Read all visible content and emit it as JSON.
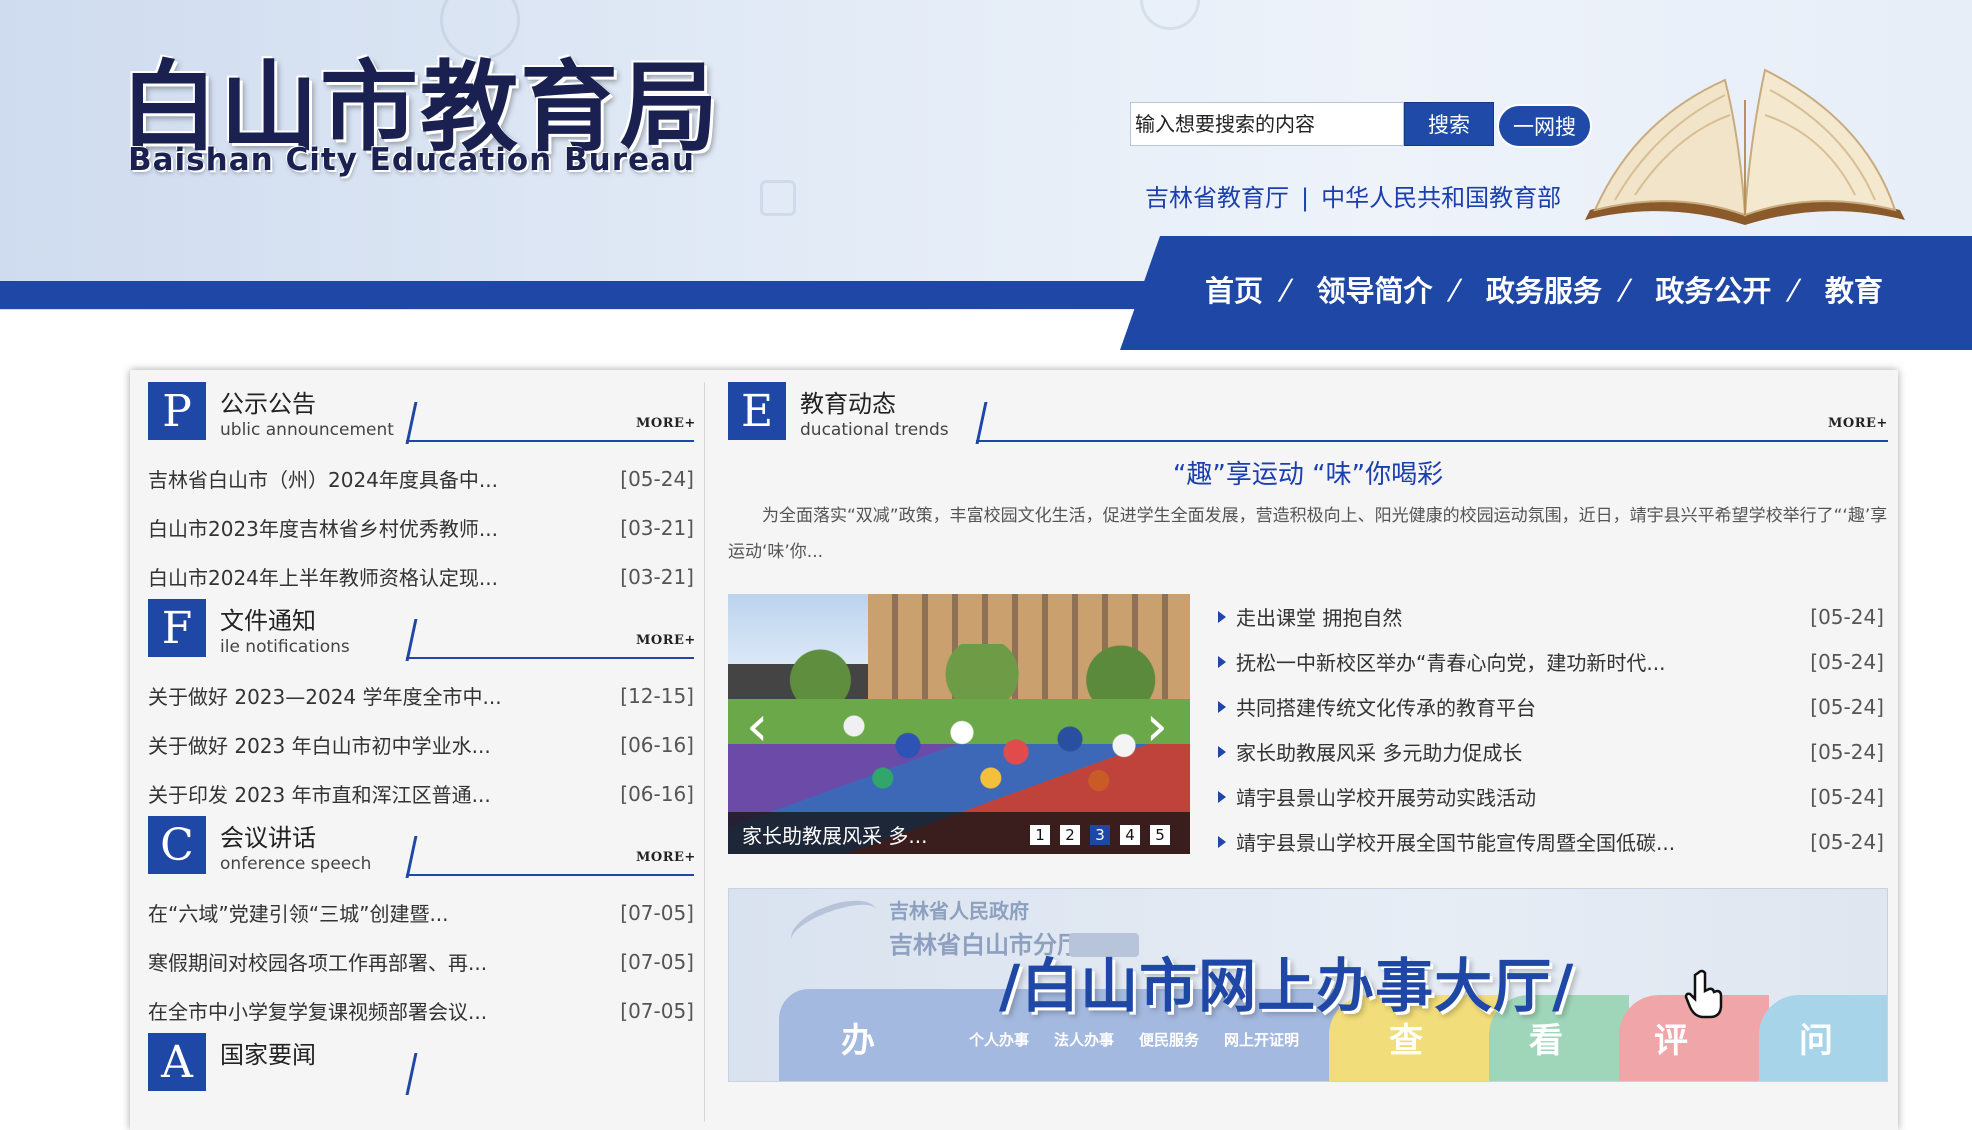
{
  "header": {
    "logo_cn": "白山市教育局",
    "logo_en": "Baishan City Education Bureau",
    "search_placeholder": "输入想要搜索的内容",
    "search_button": "搜索",
    "web_search_button": "一网搜",
    "links": [
      "吉林省教育厅",
      "中华人民共和国教育部"
    ],
    "link_separator": "|"
  },
  "nav": {
    "items": [
      "首页",
      "领导简介",
      "政务服务",
      "政务公开",
      "教育"
    ],
    "separator": "/"
  },
  "sections": [
    {
      "letter": "P",
      "title": "公示公告",
      "subtitle": "ublic announcement",
      "more": "MORE+",
      "items": [
        {
          "text": "吉林省白山市（州）2024年度具备中...",
          "date": "[05-24]"
        },
        {
          "text": "白山市2023年度吉林省乡村优秀教师...",
          "date": "[03-21]"
        },
        {
          "text": "白山市2024年上半年教师资格认定现...",
          "date": "[03-21]"
        }
      ]
    },
    {
      "letter": "F",
      "title": "文件通知",
      "subtitle": "ile notifications",
      "more": "MORE+",
      "items": [
        {
          "text": "关于做好 2023—2024 学年度全市中...",
          "date": "[12-15]"
        },
        {
          "text": "关于做好 2023 年白山市初中学业水...",
          "date": "[06-16]"
        },
        {
          "text": "关于印发 2023 年市直和浑江区普通...",
          "date": "[06-16]"
        }
      ]
    },
    {
      "letter": "C",
      "title": "会议讲话",
      "subtitle": "onference speech",
      "more": "MORE+",
      "items": [
        {
          "text": "在“六域”党建引领“三城”创建暨...",
          "date": "[07-05]"
        },
        {
          "text": "寒假期间对校园各项工作再部署、再...",
          "date": "[07-05]"
        },
        {
          "text": "在全市中小学复学复课视频部署会议...",
          "date": "[07-05]"
        }
      ]
    },
    {
      "letter": "A",
      "title": "国家要闻"
    }
  ],
  "education_news": {
    "letter": "E",
    "title": "教育动态",
    "subtitle": "ducational trends",
    "more": "MORE+",
    "headline": "“趣”享运动 “味”你喝彩",
    "summary": "为全面落实“双减”政策，丰富校园文化生活，促进学生全面发展，营造积极向上、阳光健康的校园运动氛围，近日，靖宇县兴平希望学校举行了“‘趣’享运动‘味’你...",
    "slider": {
      "caption": "家长助教展风采 多...",
      "dots": [
        "1",
        "2",
        "3",
        "4",
        "5"
      ],
      "active_dot": 3,
      "prev": "‹",
      "next": "›"
    },
    "items": [
      {
        "text": "走出课堂 拥抱自然",
        "date": "[05-24]"
      },
      {
        "text": "抚松一中新校区举办“青春心向党，建功新时代...",
        "date": "[05-24]"
      },
      {
        "text": "共同搭建传统文化传承的教育平台",
        "date": "[05-24]"
      },
      {
        "text": "家长助教展风采 多元助力促成长",
        "date": "[05-24]"
      },
      {
        "text": "靖宇县景山学校开展劳动实践活动",
        "date": "[05-24]"
      },
      {
        "text": "靖宇县景山学校开展全国节能宣传周暨全国低碳...",
        "date": "[05-24]"
      }
    ]
  },
  "banner": {
    "gov_line1": "吉林省人民政府",
    "gov_line2": "吉林省白山市分厅",
    "main": "/白山市网上办事大厅/",
    "small_labels": [
      "个人办事",
      "法人办事",
      "便民服务",
      "网上开证明"
    ],
    "big_labels": [
      "办",
      "查",
      "看",
      "评",
      "问"
    ]
  },
  "colors": {
    "brand_blue": "#1f47a6",
    "link_blue": "#1c3fb0"
  }
}
